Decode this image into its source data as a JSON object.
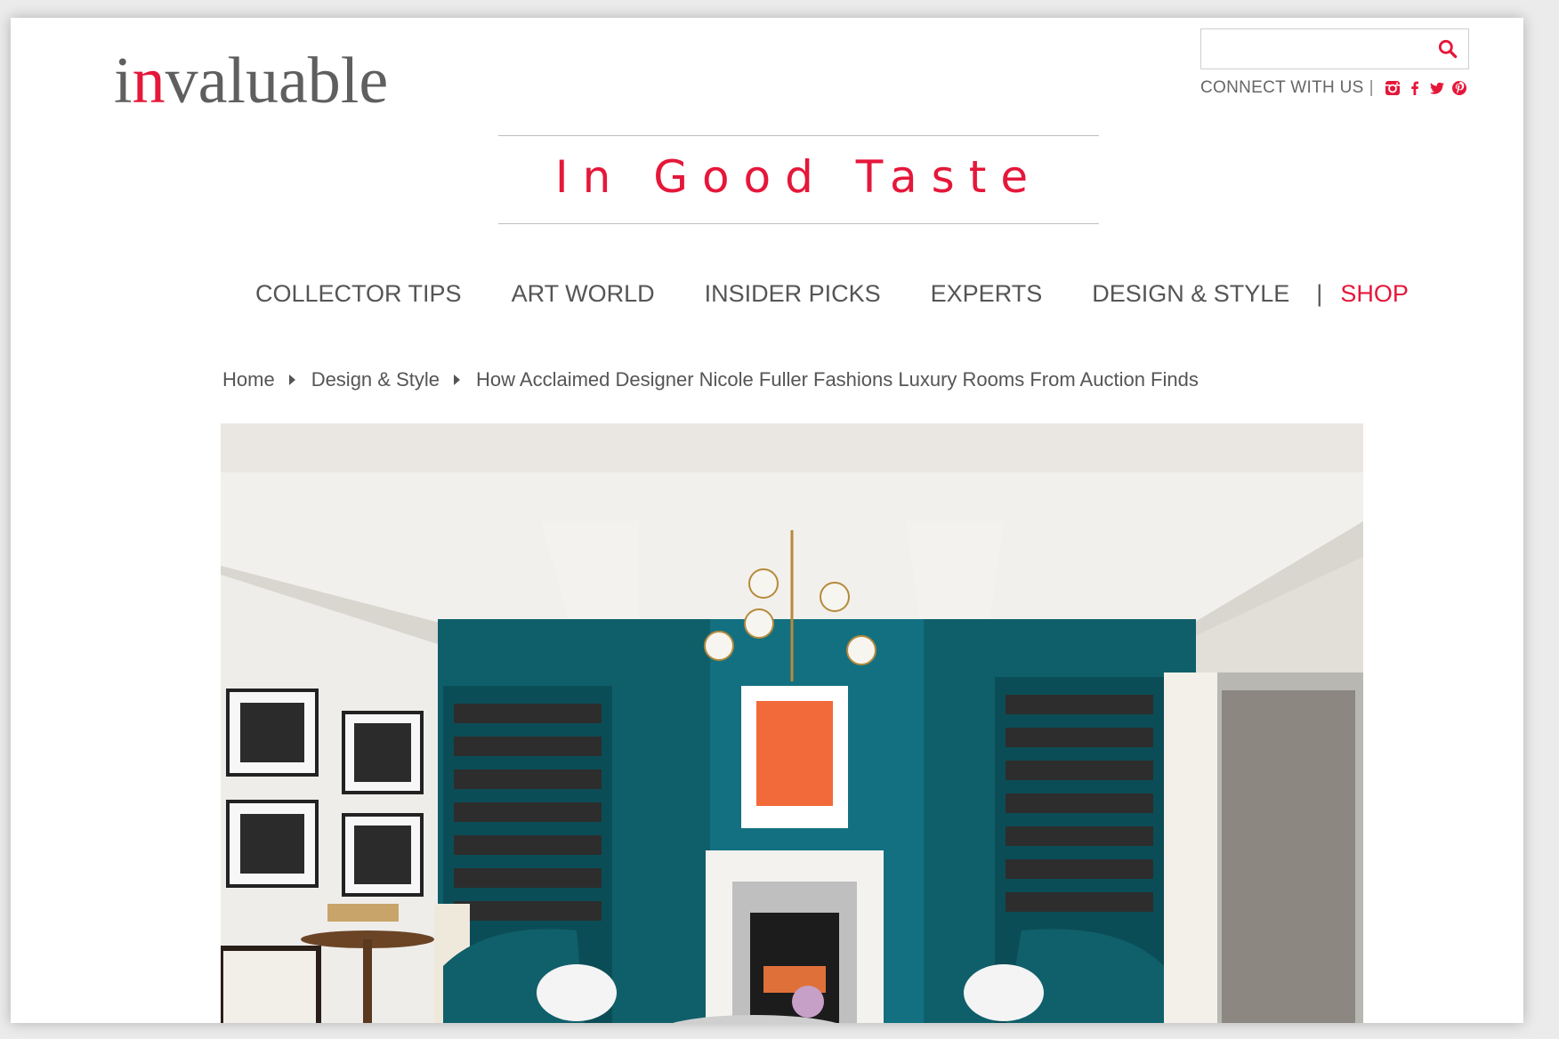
{
  "site": {
    "logo_main": "invaluable",
    "logo_parts": [
      "i",
      "n",
      "valuable"
    ]
  },
  "header": {
    "search_placeholder": "",
    "connect_label": "CONNECT WITH US",
    "connect_sep": "|",
    "social": [
      "instagram-icon",
      "facebook-icon",
      "twitter-icon",
      "pinterest-icon"
    ]
  },
  "tagline": "In Good Taste",
  "nav": {
    "items": [
      {
        "label": "COLLECTOR TIPS"
      },
      {
        "label": "ART WORLD"
      },
      {
        "label": "INSIDER PICKS"
      },
      {
        "label": "EXPERTS"
      },
      {
        "label": "DESIGN & STYLE"
      }
    ],
    "divider": "|",
    "shop_label": "SHOP"
  },
  "breadcrumb": {
    "home": "Home",
    "section": "Design & Style",
    "current": "How Acclaimed Designer Nicole Fuller Fashions Luxury Rooms From Auction Finds"
  },
  "colors": {
    "accent": "#e5173a",
    "text": "#555555",
    "teal": "#0f5f6a"
  }
}
